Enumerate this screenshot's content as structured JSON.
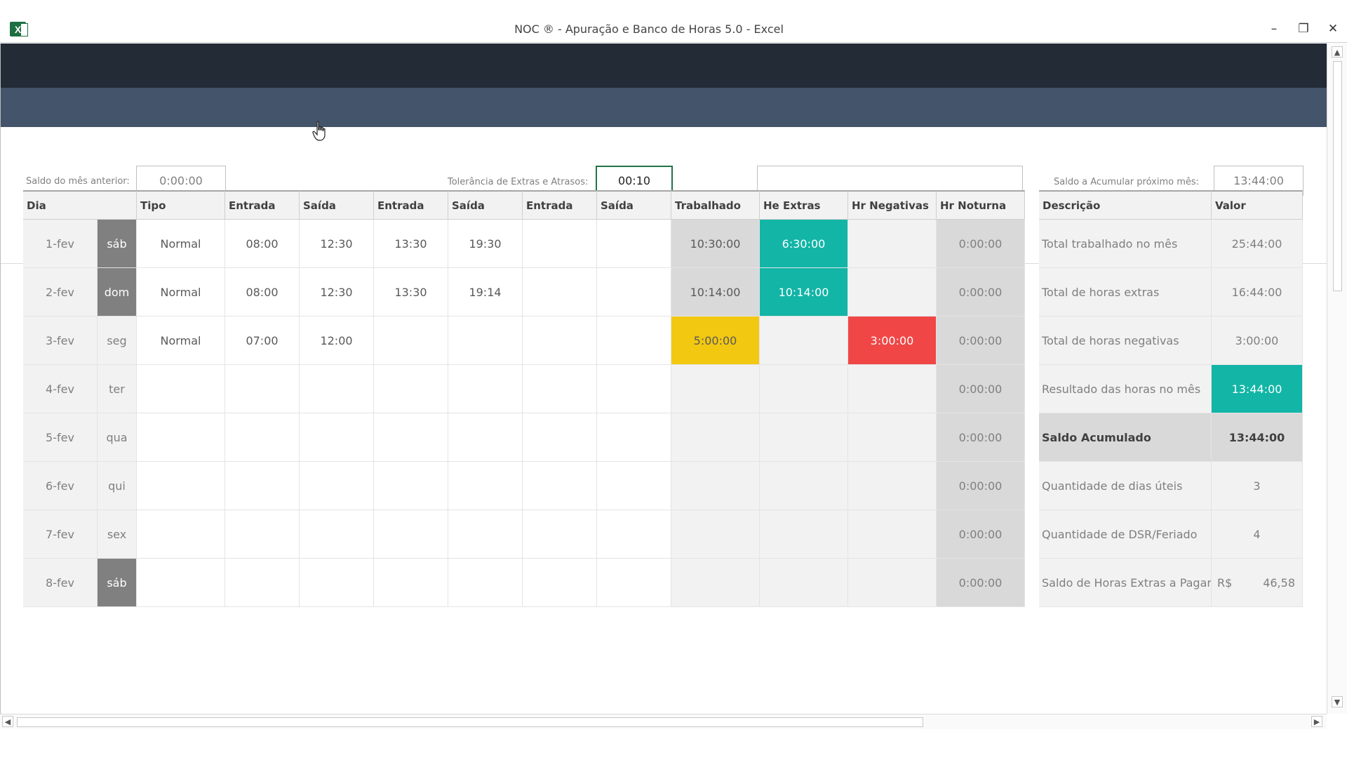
{
  "window": {
    "title": "NOC ® - Apuração e Banco de Horas 5.0 - Excel",
    "app_icon": "excel-icon",
    "app_icon_letter": "X",
    "minimize_glyph": "–",
    "restore_glyph": "❐",
    "close_glyph": "✕"
  },
  "controls": {
    "saldo_anterior_label": "Saldo do mês anterior:",
    "saldo_anterior_value": "0:00:00",
    "tolerancia_label": "Tolerância de Extras e Atrasos:",
    "tolerancia_value": "00:10",
    "blank_value": "",
    "saldo_acumular_label": "Saldo a Acumular próximo mês:",
    "saldo_acumular_value": "13:44:00"
  },
  "table": {
    "headers": [
      "Dia",
      "Tipo",
      "Entrada",
      "Saída",
      "Entrada",
      "Saída",
      "Entrada",
      "Saída",
      "Trabalhado",
      "He Extras",
      "Hr Negativas",
      "Hr Noturna"
    ],
    "rows": [
      {
        "dia": "1-fev",
        "wd": "sáb",
        "tipo": "Normal",
        "e1": "08:00",
        "s1": "12:30",
        "e2": "13:30",
        "s2": "19:30",
        "e3": "",
        "s3": "",
        "trab": "10:30:00",
        "extras": "6:30:00",
        "neg": "",
        "noturna": "0:00:00"
      },
      {
        "dia": "2-fev",
        "wd": "dom",
        "tipo": "Normal",
        "e1": "08:00",
        "s1": "12:30",
        "e2": "13:30",
        "s2": "19:14",
        "e3": "",
        "s3": "",
        "trab": "10:14:00",
        "extras": "10:14:00",
        "neg": "",
        "noturna": "0:00:00"
      },
      {
        "dia": "3-fev",
        "wd": "seg",
        "tipo": "Normal",
        "e1": "07:00",
        "s1": "12:00",
        "e2": "",
        "s2": "",
        "e3": "",
        "s3": "",
        "trab": "5:00:00",
        "extras": "",
        "neg": "3:00:00",
        "noturna": "0:00:00"
      },
      {
        "dia": "4-fev",
        "wd": "ter",
        "tipo": "",
        "e1": "",
        "s1": "",
        "e2": "",
        "s2": "",
        "e3": "",
        "s3": "",
        "trab": "",
        "extras": "",
        "neg": "",
        "noturna": "0:00:00"
      },
      {
        "dia": "5-fev",
        "wd": "qua",
        "tipo": "",
        "e1": "",
        "s1": "",
        "e2": "",
        "s2": "",
        "e3": "",
        "s3": "",
        "trab": "",
        "extras": "",
        "neg": "",
        "noturna": "0:00:00"
      },
      {
        "dia": "6-fev",
        "wd": "qui",
        "tipo": "",
        "e1": "",
        "s1": "",
        "e2": "",
        "s2": "",
        "e3": "",
        "s3": "",
        "trab": "",
        "extras": "",
        "neg": "",
        "noturna": "0:00:00"
      },
      {
        "dia": "7-fev",
        "wd": "sex",
        "tipo": "",
        "e1": "",
        "s1": "",
        "e2": "",
        "s2": "",
        "e3": "",
        "s3": "",
        "trab": "",
        "extras": "",
        "neg": "",
        "noturna": "0:00:00"
      },
      {
        "dia": "8-fev",
        "wd": "sáb",
        "tipo": "",
        "e1": "",
        "s1": "",
        "e2": "",
        "s2": "",
        "e3": "",
        "s3": "",
        "trab": "",
        "extras": "",
        "neg": "",
        "noturna": "0:00:00"
      }
    ]
  },
  "summary": {
    "headers": [
      "Descrição",
      "Valor"
    ],
    "rows": [
      {
        "desc": "Total trabalhado no mês",
        "valor": "25:44:00"
      },
      {
        "desc": "Total de horas extras",
        "valor": "16:44:00"
      },
      {
        "desc": "Total de horas negativas",
        "valor": "3:00:00"
      },
      {
        "desc": "Resultado das horas no mês",
        "valor": "13:44:00"
      },
      {
        "desc": "Saldo Acumulado",
        "valor": "13:44:00"
      },
      {
        "desc": "Quantidade de dias úteis",
        "valor": "3"
      },
      {
        "desc": "Quantidade de DSR/Feriado",
        "valor": "4"
      },
      {
        "desc": "Saldo de Horas Extras a Pagar",
        "valor_prefix": "R$",
        "valor": "46,58"
      }
    ]
  },
  "colors": {
    "teal": "#12b5a6",
    "yellow": "#f2c811",
    "red": "#f04646",
    "weekend_gray": "#808080",
    "light_gray": "#d9d9d9",
    "row_gray": "#f2f2f2"
  }
}
